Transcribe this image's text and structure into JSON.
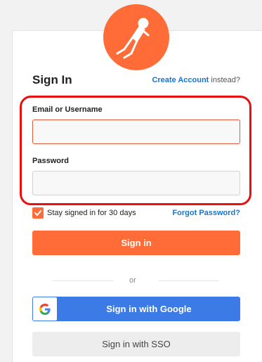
{
  "header": {
    "title": "Sign In",
    "create_account_link": "Create Account",
    "create_account_suffix": " instead?"
  },
  "form": {
    "email_label": "Email or Username",
    "email_value": "",
    "password_label": "Password",
    "password_value": "",
    "stay_signed_in": "Stay signed in for 30 days",
    "stay_signed_in_checked": true,
    "forgot_password": "Forgot Password?",
    "signin_button": "Sign in"
  },
  "alt": {
    "or_text": "or",
    "google_button": "Sign in with Google",
    "sso_button": "Sign in with SSO"
  },
  "colors": {
    "brand": "#ff6c37",
    "link": "#1a73c9",
    "google": "#3c7ae6",
    "highlight": "#e8100e"
  }
}
